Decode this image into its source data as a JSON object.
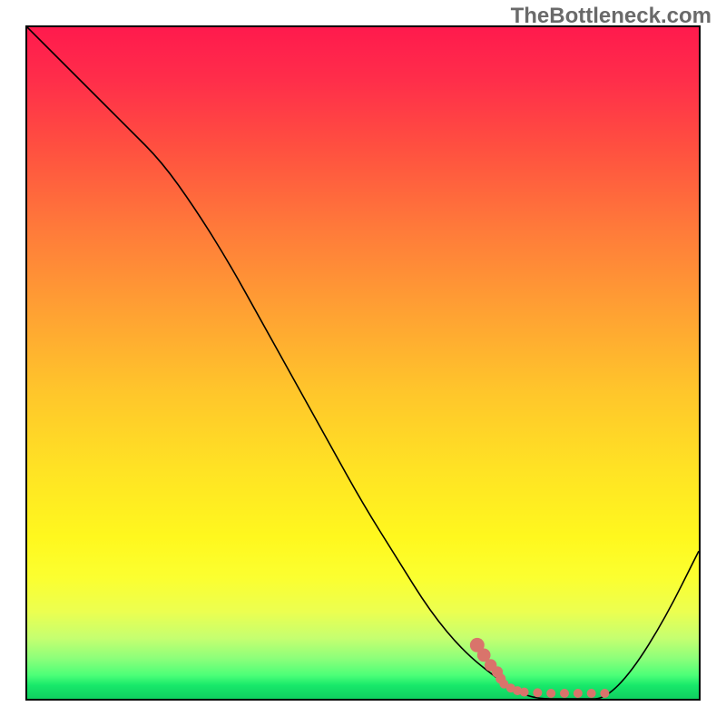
{
  "watermark": "TheBottleneck.com",
  "chart_data": {
    "type": "line",
    "title": "",
    "xlabel": "",
    "ylabel": "",
    "xlim": [
      0,
      100
    ],
    "ylim": [
      0,
      100
    ],
    "grid": false,
    "series": [
      {
        "name": "bottleneck-curve",
        "color": "#000000",
        "x": [
          0,
          5,
          10,
          15,
          20,
          25,
          30,
          35,
          40,
          45,
          50,
          55,
          60,
          65,
          70,
          73,
          76,
          80,
          83,
          86,
          90,
          95,
          100
        ],
        "y": [
          100,
          95,
          90,
          85,
          80,
          73,
          65,
          56,
          47,
          38,
          29,
          21,
          13,
          7,
          3,
          1,
          0,
          0,
          0,
          0,
          4,
          12,
          22
        ]
      },
      {
        "name": "optimal-zone-marker",
        "color": "#d9746b",
        "type": "scatter",
        "x": [
          67,
          68,
          69,
          70,
          70.5,
          71,
          72,
          73,
          74,
          76,
          78,
          80,
          82,
          84,
          86
        ],
        "y": [
          8,
          6.5,
          5,
          4,
          3,
          2.2,
          1.6,
          1.2,
          1,
          0.9,
          0.8,
          0.8,
          0.8,
          0.8,
          0.8
        ]
      }
    ],
    "gradient_stops": [
      {
        "pos": 0.0,
        "color": "#ff1a4d"
      },
      {
        "pos": 0.18,
        "color": "#ff5040"
      },
      {
        "pos": 0.42,
        "color": "#ffa033"
      },
      {
        "pos": 0.66,
        "color": "#ffe324"
      },
      {
        "pos": 0.82,
        "color": "#fbff30"
      },
      {
        "pos": 0.94,
        "color": "#8cff7a"
      },
      {
        "pos": 1.0,
        "color": "#0fd060"
      }
    ]
  }
}
